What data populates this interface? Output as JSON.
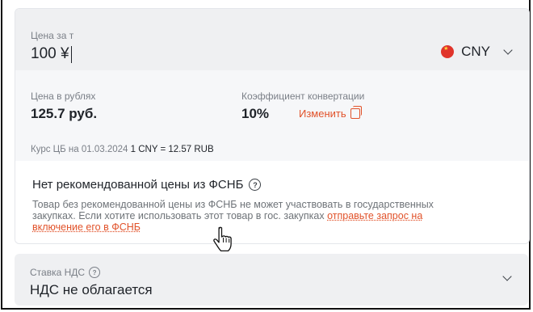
{
  "price": {
    "label": "Цена за т",
    "value": "100 ¥",
    "currency": {
      "code": "CNY",
      "flag_icon": "china-flag-icon"
    }
  },
  "conversion": {
    "rub_label": "Цена в рублях",
    "rub_value": "125.7 руб.",
    "coef_label": "Коэффициент конвертации",
    "coef_value": "10%",
    "change_label": "Изменить",
    "rate_prefix": "Курс ЦБ на 01.03.2024",
    "rate_value": "1 CNY = 12.57 RUB"
  },
  "notice": {
    "title": "Нет рекомендованной цены из ФСНБ",
    "text": "Товар без рекомендованной цены из ФСНБ не может участвовать в государственных закупках. Если хотите использовать этот товар в гос. закупках",
    "link": "отправьте запрос на включение его в ФСНБ"
  },
  "vat": {
    "label": "Ставка НДС",
    "value": "НДС не облагается"
  },
  "colors": {
    "accent": "#e1522a",
    "field_bg": "#eff0f2",
    "section_bg": "#f6f7f9"
  }
}
